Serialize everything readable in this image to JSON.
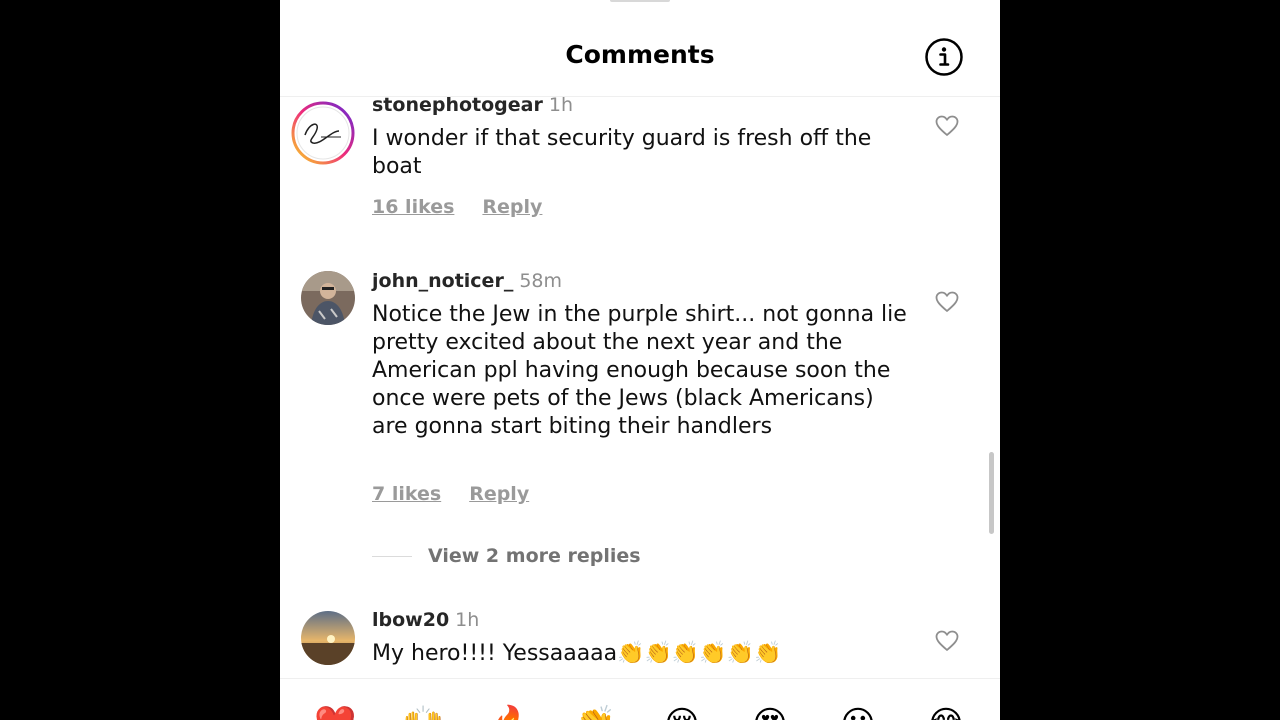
{
  "header": {
    "title": "Comments",
    "info_icon": "info-circle-icon"
  },
  "comments": [
    {
      "username": "stonephotogear",
      "time": "1h",
      "text": "I wonder if that security guard is fresh off the boat",
      "likes": "16 likes",
      "reply": "Reply"
    },
    {
      "username": "john_noticer_",
      "time": "58m",
      "text": "Notice the Jew in the purple shirt... not gonna lie pretty excited about the next year and the American ppl having enough because soon the once were pets of the Jews (black Americans) are gonna start biting their handlers",
      "likes": "7 likes",
      "reply": "Reply",
      "view_replies": "View 2 more replies"
    },
    {
      "username": "lbow20",
      "time": "1h",
      "text": "My hero!!!! Yessaaaaa👏👏👏👏👏👏"
    }
  ],
  "emoji_bar": [
    "❤️",
    "🙌",
    "🔥",
    "👏",
    "😢",
    "😍",
    "😮",
    "😂"
  ],
  "colors": {
    "brand_ring": "#d6249f",
    "text_secondary": "#8e8e8e"
  }
}
